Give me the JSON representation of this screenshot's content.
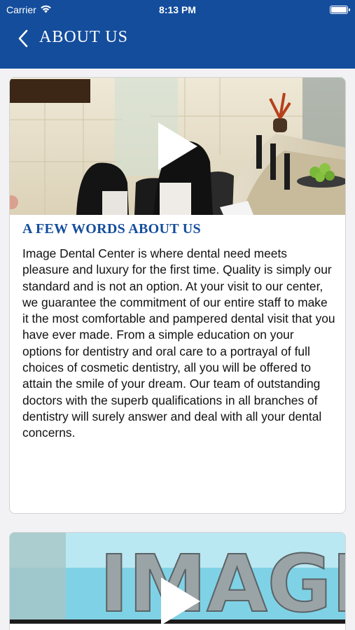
{
  "status_bar": {
    "carrier": "Carrier",
    "time": "8:13 PM",
    "icons": [
      "wifi-icon",
      "battery-icon"
    ]
  },
  "nav": {
    "title": "ABOUT US",
    "back_icon": "chevron-left-icon"
  },
  "cards": [
    {
      "media": {
        "type": "video",
        "icon": "play-icon"
      },
      "title": "A FEW WORDS ABOUT US",
      "body": "Image Dental Center is where dental need meets pleasure and luxury for the first time. Quality is simply our standard and is not an option. At your visit to our center, we guarantee the commitment of our entire staff to make it the most comfortable and pampered dental visit that you have ever made. From a simple education on your options for dentistry and oral care to a portrayal of full choices of cosmetic dentistry, all you will be offered to attain the smile of your dream. Our team of outstanding doctors with the superb qualifications in all branches of dentistry will surely answer and deal with all your dental concerns."
    },
    {
      "media": {
        "type": "video",
        "icon": "play-icon",
        "sign_text": "IMAGE"
      }
    }
  ],
  "colors": {
    "primary": "#144d9c",
    "title_text": "#144d9c",
    "body_text": "#111111",
    "background": "#f2f2f4",
    "card": "#ffffff"
  }
}
